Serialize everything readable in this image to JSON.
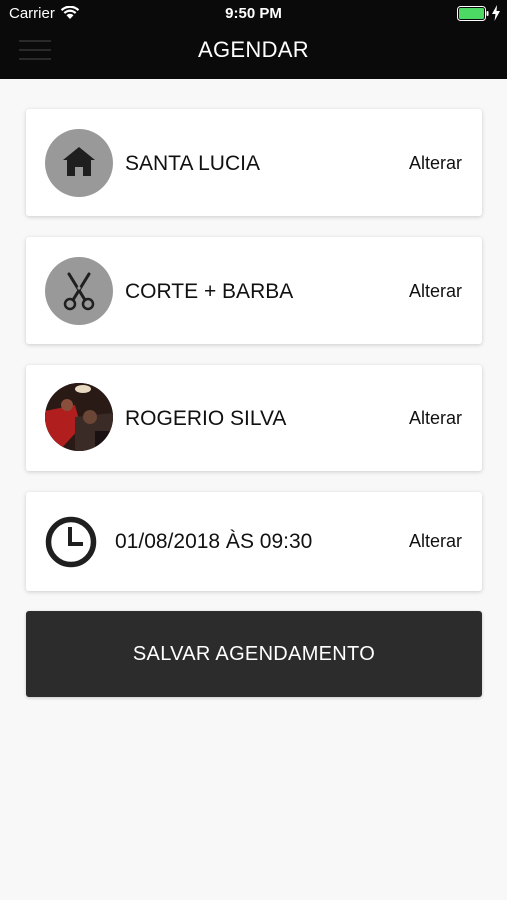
{
  "status_bar": {
    "carrier": "Carrier",
    "time": "9:50 PM",
    "battery_color": "#4cd964"
  },
  "header": {
    "title": "AGENDAR",
    "menu_icon": "hamburger-menu-icon"
  },
  "cards": [
    {
      "icon": "home-icon",
      "label": "SANTA LUCIA",
      "action": "Alterar"
    },
    {
      "icon": "scissors-icon",
      "label": "CORTE + BARBA",
      "action": "Alterar"
    },
    {
      "icon": "barber-avatar",
      "label": "ROGERIO SILVA",
      "action": "Alterar"
    },
    {
      "icon": "clock-icon",
      "label": "01/08/2018 ÀS 09:30",
      "action": "Alterar"
    }
  ],
  "save_button": {
    "label": "SALVAR AGENDAMENTO"
  },
  "colors": {
    "header_bg": "#0a0a0a",
    "page_bg": "#f8f8f8",
    "icon_circle": "#999999",
    "button_bg": "#2c2c2c"
  }
}
